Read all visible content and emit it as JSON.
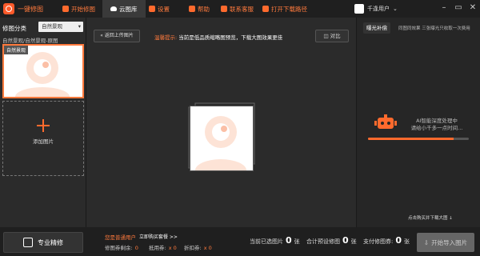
{
  "app": {
    "title": "一键修图"
  },
  "tabs": [
    {
      "label": "开始修图"
    },
    {
      "label": "云图库"
    },
    {
      "label": "设置"
    },
    {
      "label": "帮助"
    },
    {
      "label": "联系客服"
    },
    {
      "label": "打开下载路径"
    }
  ],
  "user": {
    "name": "千逢用户"
  },
  "left_panel": {
    "classify_label": "修图分类",
    "classify_value": "自然景观",
    "sub_label": "自然景观/自然景观-原图",
    "thumb_tag": "自然景观",
    "add_label": "添加图片"
  },
  "preview": {
    "back_label": "返回上传图片",
    "tip_prefix": "温馨提示:",
    "tip_text": "当前是低品质缩略图预览，下载大图效果更佳",
    "compare_label": "对比"
  },
  "right_panel": {
    "brightness_label": "曝光补偿",
    "brightness_desc": "同图同效果 三张曝光只收取一次费用",
    "ai_line1": "AI智能深度处理中",
    "ai_line2": "请给小千多一点时间...",
    "progress": 0.85,
    "buy_note": "点击购买并下载大图 ↓"
  },
  "bottom": {
    "pro_label": "专业精修",
    "user_type": "您是普通用户",
    "buy_link": "立即购买套餐 >>",
    "quota": [
      {
        "label": "修图券剩余:",
        "value": "0"
      },
      {
        "label": "抵用券:",
        "value": "x 0"
      },
      {
        "label": "折扣券:",
        "value": "x 0"
      }
    ],
    "stats": [
      {
        "label": "当前已选图片",
        "value": "0",
        "unit": "张"
      },
      {
        "label": "合计预设修图",
        "value": "0",
        "unit": "张"
      },
      {
        "label": "支付修图券:",
        "value": "0",
        "unit": "张"
      }
    ],
    "export_label": "开始导入图片"
  },
  "colors": {
    "accent": "#ff6a2d",
    "bg": "#2b2b2b",
    "bar": "#1f1f1f"
  }
}
